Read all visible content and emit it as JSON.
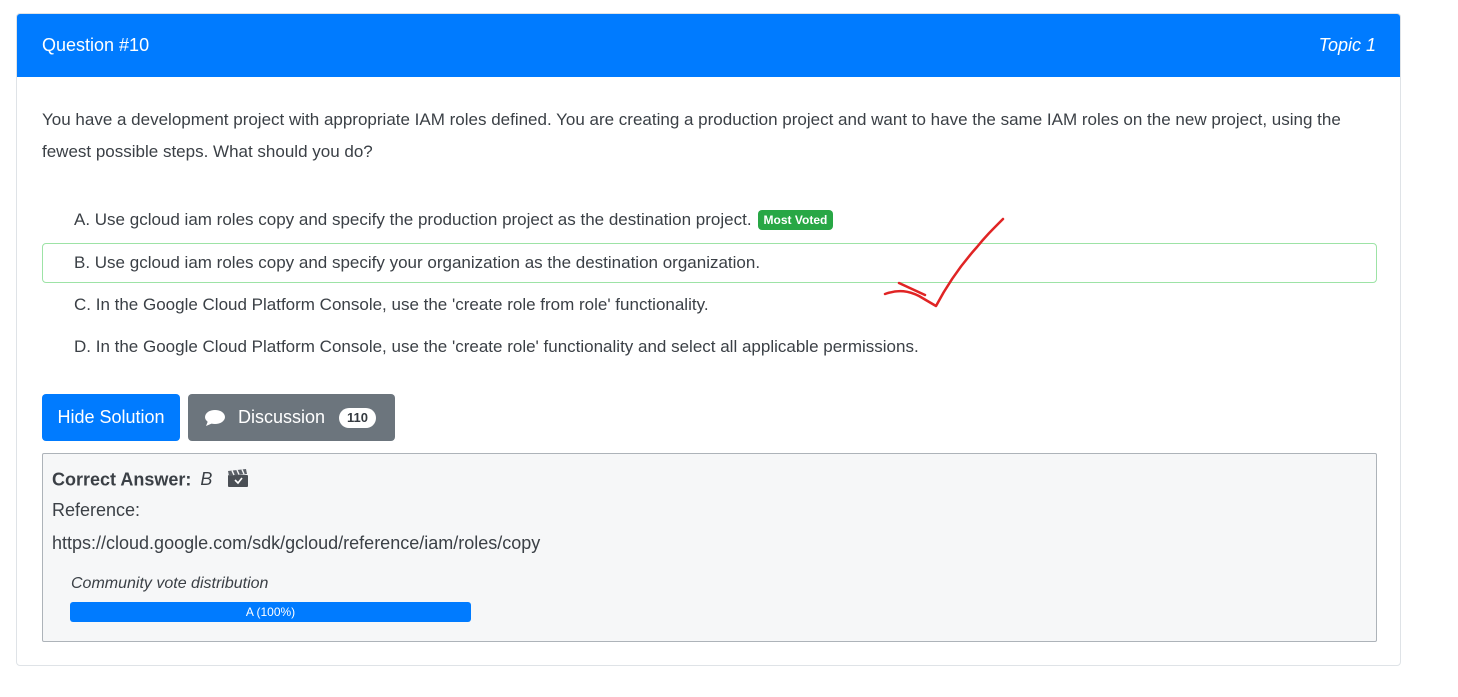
{
  "header": {
    "question_number": "Question #10",
    "topic": "Topic 1",
    "background_color": "#007bff"
  },
  "question": {
    "text": "You have a development project with appropriate IAM roles defined. You are creating a production project and want to have the same IAM roles on the new project, using the fewest possible steps. What should you do?"
  },
  "choices": [
    {
      "label": "A. Use gcloud iam roles copy and specify the production project as the destination project.",
      "badge": "Most Voted"
    },
    {
      "label": "B. Use gcloud iam roles copy and specify your organization as the destination organization.",
      "highlighted": true
    },
    {
      "label": "C. In the Google Cloud Platform Console, use the 'create role from role' functionality."
    },
    {
      "label": "D. In the Google Cloud Platform Console, use the 'create role' functionality and select all applicable permissions."
    }
  ],
  "buttons": {
    "hide_solution": "Hide Solution",
    "discussion": "Discussion",
    "discussion_count": "110",
    "discussion_icon": "chat-bubble-icon"
  },
  "answer": {
    "correct_label": "Correct Answer:",
    "correct_value": "B",
    "correct_icon": "clapperboard-icon",
    "reference_label": "Reference:",
    "reference_url": "https://cloud.google.com/sdk/gcloud/reference/iam/roles/copy"
  },
  "community_vote": {
    "title": "Community vote distribution",
    "bar_label": "A (100%)",
    "fraction": 1.0
  },
  "colors": {
    "primary": "#007bff",
    "secondary": "#6c757d",
    "success": "#28a745",
    "annotation": "#e02424"
  }
}
